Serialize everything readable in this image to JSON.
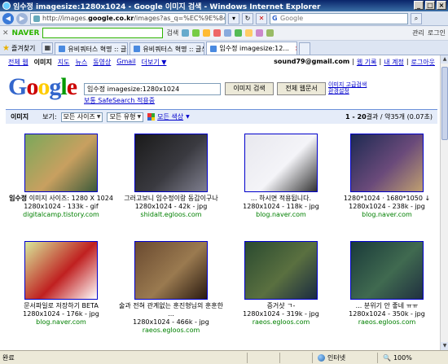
{
  "window": {
    "title": "임수정 imagesize:1280x1024 - Google 이미지 검색 - Windows Internet Explorer",
    "buttons": [
      "_",
      "□",
      "×"
    ]
  },
  "address_bar": {
    "url_prefix": "http://images.",
    "url_domain": "google.co.kr",
    "url_rest": "/images?as_q=%EC%9E%84%EC%88%98",
    "search_placeholder": "Google"
  },
  "naver_toolbar": {
    "logo": "NAVER",
    "search_label": "검색",
    "items": [
      "관리",
      "로그인"
    ]
  },
  "tabs_bar": {
    "favorites": "즐겨찾기",
    "tabs": [
      {
        "label": "유비쿼터스 혁명 :: 글쓰기",
        "active": false
      },
      {
        "label": "유비쿼터스 혁명 :: 글쓰기",
        "active": false
      },
      {
        "label": "임수정 imagesize:12...",
        "active": true
      }
    ]
  },
  "google": {
    "nav_links": [
      "전체 웹",
      "이미지",
      "지도",
      "뉴스",
      "동영상",
      "Gmail",
      "더보기 ▼"
    ],
    "current_nav": "이미지",
    "user_email": "sound79@gmail.com",
    "user_links": [
      "웹 기록",
      "내 계정",
      "로그아웃"
    ],
    "logo_letters": [
      "G",
      "o",
      "o",
      "g",
      "l",
      "e"
    ],
    "query": "임수정 imagesize:1280x1024",
    "search_button": "이미지 검색",
    "web_button": "전체 웹문서",
    "advanced_links": [
      "이미지 고급검색",
      "환경설정"
    ],
    "safesearch": "보통 SafeSearch 적용중"
  },
  "filter_bar": {
    "title": "이미지",
    "view_label": "보기:",
    "size_select": "모든 사이즈",
    "type_select": "모든 유형",
    "color_select": "모든 색상",
    "results_prefix": "1 - 20",
    "results_suffix": "결과 / 약35개 (0.07초)"
  },
  "results": [
    {
      "caption": "임수정 이미지 사이즈: 1280 X 1024",
      "bold": "임수정",
      "meta": "1280x1024 - 133k - gif",
      "site": "digitalcamp.tistory.com",
      "palette": [
        "#7aa85a",
        "#c8a060",
        "#3d5a3a"
      ]
    },
    {
      "caption": "그러고보니 임수정이랑 동갑이구나",
      "bold": "임수정",
      "meta": "1280x1024 - 42k - jpg",
      "site": "shidalt.egloos.com",
      "palette": [
        "#1a1a1a",
        "#3a3a40",
        "#808090"
      ]
    },
    {
      "caption": "... 하시면 적용됩니다.",
      "bold": "",
      "meta": "1280x1024 - 118k - jpg",
      "site": "blog.naver.com",
      "palette": [
        "#e8e8ee",
        "#f4f4f8",
        "#333"
      ]
    },
    {
      "caption": "1280*1024 · 1680*1050 ↓",
      "bold": "",
      "meta": "1280x1024 - 238k - jpg",
      "site": "blog.naver.com",
      "palette": [
        "#1d2a52",
        "#6a4a7a",
        "#c0a070"
      ]
    },
    {
      "caption": "문서파일로 저장하기 BETA",
      "bold": "",
      "meta": "1280x1024 - 176k - jpg",
      "site": "blog.naver.com",
      "palette": [
        "#d8e89a",
        "#c02020",
        "#ffffff"
      ]
    },
    {
      "caption": "술과 전혀 관계없는 훈진형님의 훈훈한 ...",
      "bold": "",
      "meta": "1280x1024 - 466k - jpg",
      "site": "raeos.egloos.com",
      "palette": [
        "#6a4a30",
        "#9a7a50",
        "#2a1a10"
      ]
    },
    {
      "caption": "증거샷 ㄱ-",
      "bold": "",
      "meta": "1280x1024 - 319k - jpg",
      "site": "raeos.egloos.com",
      "palette": [
        "#2a4a30",
        "#5a7040",
        "#1a2a40"
      ]
    },
    {
      "caption": "... 분위기 안 좋네 ㅠㅠ",
      "bold": "",
      "meta": "1280x1024 - 350k - jpg",
      "site": "raeos.egloos.com",
      "palette": [
        "#1a3a3a",
        "#406a50",
        "#203040"
      ]
    }
  ],
  "status_bar": {
    "left": "완료",
    "zone": "인터넷",
    "zoom": "100%"
  }
}
